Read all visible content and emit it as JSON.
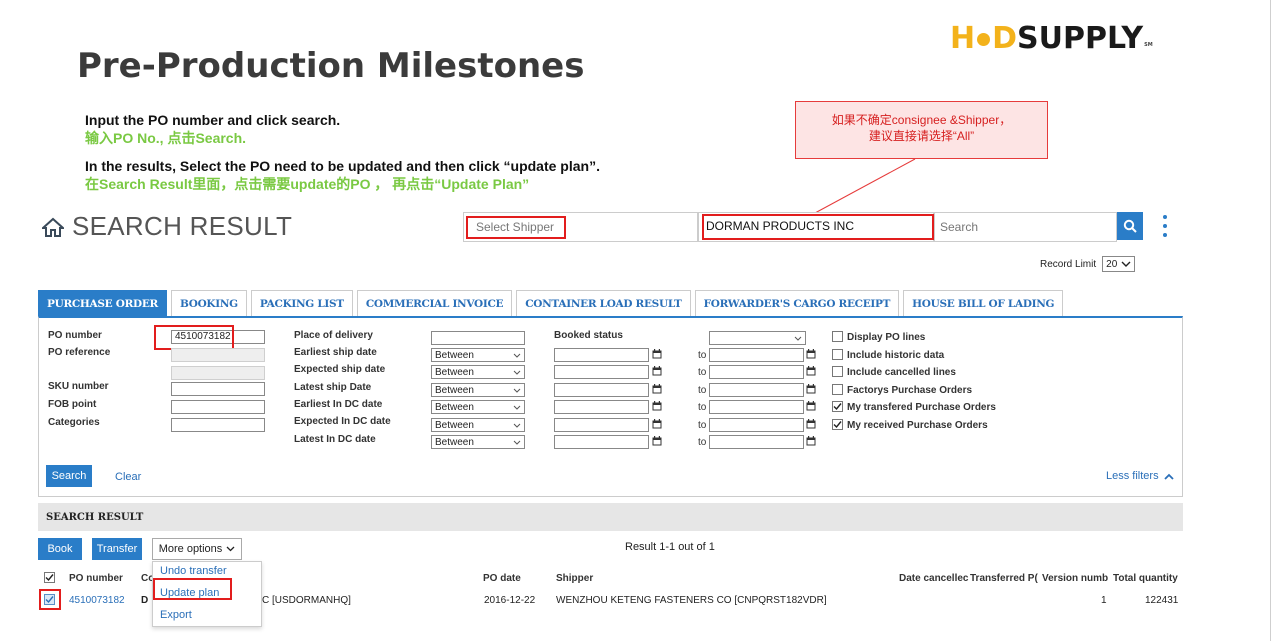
{
  "slide": {
    "title": "Pre-Production Milestones",
    "instructions": {
      "line1_en": "Input the PO number and click search.",
      "line1_zh": "输入PO No., 点击Search.",
      "line2_en": "In the results, Select the PO need to be updated and then click “update plan”.",
      "line2_zh": "在Search Result里面，点击需要update的PO ， 再点击“Update Plan”"
    },
    "callout": {
      "line1": "如果不确定consignee &Shipper，",
      "line2": "建议直接请选择“All”"
    },
    "logo": {
      "text_a": "H",
      "text_b": "D",
      "text_c": "SUPPLY",
      "mark": "SM",
      "brand_color": "#f3b21b"
    }
  },
  "app": {
    "section_title": "SEARCH RESULT",
    "shipper_select": "Select Shipper",
    "consignee_value": "DORMAN PRODUCTS INC",
    "search_placeholder": "Search",
    "record_limit_label": "Record Limit",
    "record_limit_value": "20",
    "tabs": [
      "PURCHASE ORDER",
      "BOOKING",
      "PACKING LIST",
      "COMMERCIAL INVOICE",
      "CONTAINER LOAD RESULT",
      "FORWARDER'S CARGO RECEIPT",
      "HOUSE BILL OF LADING"
    ],
    "filters": {
      "po_number_label": "PO number",
      "po_number_value": "4510073182",
      "po_reference_label": "PO reference",
      "sku_label": "SKU number",
      "fob_label": "FOB point",
      "categories_label": "Categories",
      "place_of_delivery": "Place of delivery",
      "earliest_ship": "Earliest ship date",
      "expected_ship": "Expected ship date",
      "latest_ship": "Latest ship Date",
      "earliest_dc": "Earliest In DC date",
      "expected_dc": "Expected In DC date",
      "latest_dc": "Latest In DC date",
      "booked_status": "Booked status",
      "between": "Between",
      "to": "to",
      "checkboxes": [
        "Display PO lines",
        "Include historic data",
        "Include cancelled lines",
        "Factorys Purchase Orders",
        "My transfered Purchase Orders",
        "My received Purchase Orders"
      ]
    },
    "search_btn": "Search",
    "clear_btn": "Clear",
    "less_filters": "Less filters",
    "result_bar": "SEARCH RESULT",
    "book_btn": "Book",
    "transfer_btn": "Transfer",
    "more_options": "More options",
    "result_count": "Result 1-1 out of 1",
    "menu_items": [
      "Undo transfer",
      "Update plan",
      "Export"
    ],
    "columns": {
      "po_number": "PO number",
      "consignee": "Co",
      "po_date": "PO date",
      "shipper": "Shipper",
      "date_cancelled": "Date cancellec",
      "transferred": "Transferred P(",
      "version": "Version numb",
      "total_qty": "Total quantity"
    },
    "row": {
      "po_number": "4510073182",
      "consignee_a": "D",
      "consignee_b": "C [USDORMANHQ]",
      "po_date": "2016-12-22",
      "shipper": "WENZHOU KETENG FASTENERS CO [CNPQRST182VDR]",
      "version": "1",
      "total_qty": "122431"
    }
  }
}
